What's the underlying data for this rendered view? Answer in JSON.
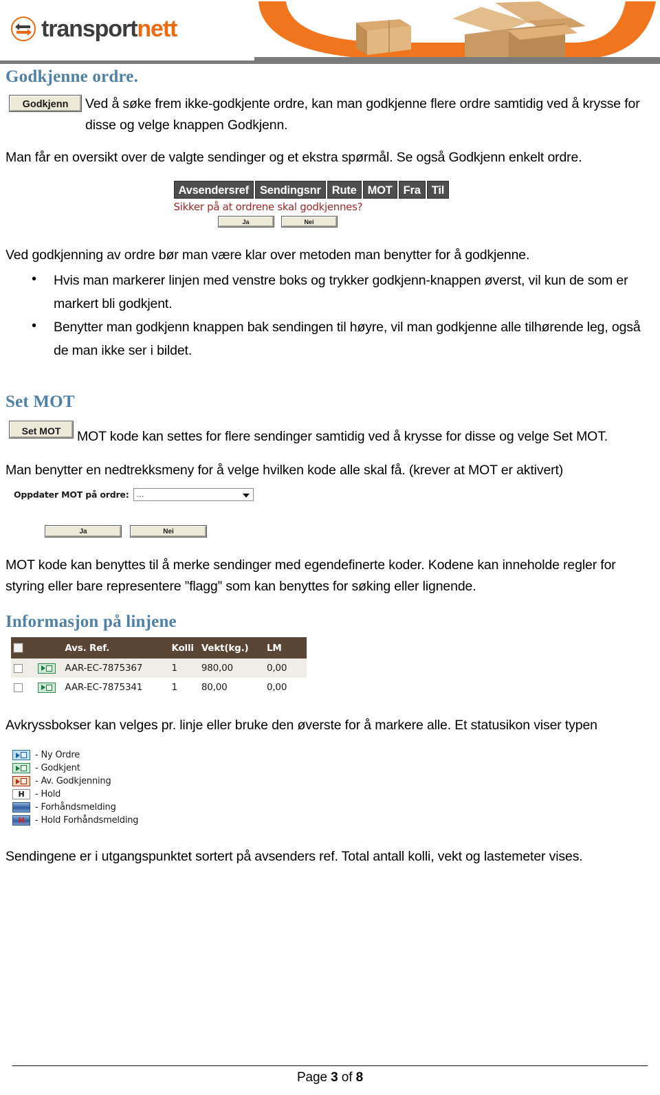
{
  "banner": {
    "logo_text_dark": "transport",
    "logo_text_orange": "nett",
    "logo_icon": "two-arrows-circle-icon",
    "art_alt": "orange-swoosh-with-cardboard-boxes"
  },
  "sections": {
    "godkjenne": {
      "title": "Godkjenne ordre.",
      "button_label": "Godkjenn",
      "paragraph1": "Ved å søke frem ikke-godkjente ordre, kan man godkjenne flere ordre samtidig ved å krysse for disse og velge knappen Godkjenn.",
      "paragraph2": "Man får en oversikt over de valgte sendinger og et ekstra spørmål. Se også Godkjenn enkelt ordre.",
      "widget": {
        "columns": [
          "Avsendersref",
          "Sendingsnr",
          "Rute",
          "MOT",
          "Fra",
          "Til"
        ],
        "confirm_question": "Sikker på at ordrene skal godkjennes?",
        "yes_label": "Ja",
        "no_label": "Nei"
      },
      "paragraph3": "Ved godkjenning av ordre bør man være klar over metoden man benytter for å godkjenne.",
      "bullets": [
        "Hvis man markerer linjen med venstre boks og trykker godkjenn-knappen øverst, vil kun de som er markert bli godkjent.",
        "Benytter man godkjenn knappen bak sendingen til høyre, vil man godkjenne alle tilhørende leg, også de man ikke ser i bildet."
      ]
    },
    "set_mot": {
      "title": "Set MOT",
      "button_label": "Set MOT",
      "paragraph1": "MOT kode kan settes for flere sendinger samtidig ved å krysse for disse og velge Set MOT.",
      "paragraph2": "Man benytter en nedtrekksmeny for å velge hvilken kode alle skal få. (krever at MOT er aktivert)",
      "dropdown": {
        "label": "Oppdater MOT på ordre:",
        "value": "...",
        "icon": "chevron-down-icon"
      },
      "yes_label": "Ja",
      "no_label": "Nei",
      "paragraph3": "MOT kode kan benyttes til å merke sendinger med egendefinerte koder. Kodene kan inneholde regler for styring eller bare representere ”flagg” som kan benyttes for søking eller lignende."
    },
    "informasjon": {
      "title": "Informasjon på linjene",
      "table": {
        "headers": [
          "",
          "",
          "Avs. Ref.",
          "Kolli",
          "Vekt(kg.)",
          "LM"
        ],
        "rows": [
          {
            "ref": "AAR-EC-7875367",
            "kolli": "1",
            "vekt": "980,00",
            "lm": "0,00",
            "status_icon": "godkjent-green-icon"
          },
          {
            "ref": "AAR-EC-7875341",
            "kolli": "1",
            "vekt": "80,00",
            "lm": "0,00",
            "status_icon": "godkjent-green-icon"
          }
        ]
      },
      "paragraph1": "Avkryssbokser kan velges pr. linje eller bruke den øverste for å markere alle. Et statusikon viser typen",
      "legend": [
        {
          "icon": "ny-ordre-blue-icon",
          "label": "Ny Ordre"
        },
        {
          "icon": "godkjent-green-icon",
          "label": "Godkjent"
        },
        {
          "icon": "av-godkjenning-red-icon",
          "label": "Av. Godkjenning"
        },
        {
          "icon": "hold-h-icon",
          "label": "Hold"
        },
        {
          "icon": "forhandsmelding-bar-icon",
          "label": "Forhåndsmelding"
        },
        {
          "icon": "hold-forhandsmelding-icon",
          "label": "Hold Forhåndsmelding"
        }
      ],
      "paragraph2": "Sendingene er i utgangspunktet sortert på avsenders ref. Total antall kolli, vekt og lastemeter vises."
    }
  },
  "footer": {
    "prefix": "Page ",
    "page": "3",
    "middle": " of ",
    "total": "8"
  },
  "colors": {
    "heading_blue": "#4f81a8",
    "brand_orange": "#ee6a10",
    "table_header_brown": "#5a4434",
    "column_header_gray": "#4e4e4e",
    "confirm_red": "#9e2a28"
  }
}
